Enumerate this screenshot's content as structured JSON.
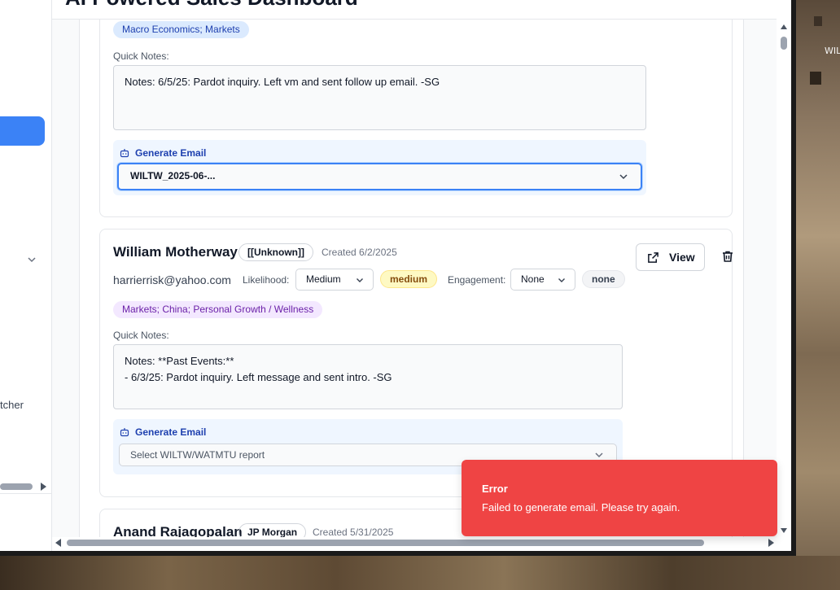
{
  "app": {
    "title": "AI Powered Sales Dashboard"
  },
  "sidebar": {
    "cut_text": "tcher"
  },
  "desktop": {
    "label": "WIL"
  },
  "cards": [
    {
      "tags": "Macro Economics; Markets",
      "notes_label": "Quick Notes:",
      "notes": "Notes: 6/5/25: Pardot inquiry. Left vm and sent follow up email. -SG",
      "generate_label": "Generate Email",
      "report_select": "WILTW_2025-06-..."
    },
    {
      "name": "William Motherway",
      "company": "[[Unknown]]",
      "created": "Created 6/2/2025",
      "email": "harrierrisk@yahoo.com",
      "likelihood_label": "Likelihood:",
      "likelihood_value": "Medium",
      "likelihood_badge": "medium",
      "engagement_label": "Engagement:",
      "engagement_value": "None",
      "engagement_badge": "none",
      "view_label": "View",
      "tags": "Markets; China; Personal Growth / Wellness",
      "notes_label": "Quick Notes:",
      "notes": "Notes: **Past Events:**\n- 6/3/25: Pardot inquiry. Left message and sent intro. -SG",
      "generate_label": "Generate Email",
      "report_placeholder": "Select WILTW/WATMTU report"
    },
    {
      "name": "Anand Rajagopalan",
      "company": "JP Morgan",
      "created": "Created 5/31/2025"
    }
  ],
  "toast": {
    "title": "Error",
    "message": "Failed to generate email. Please try again."
  },
  "colors": {
    "accent": "#3b82f6",
    "error": "#ef4444",
    "tag_blue_bg": "#dbeafe",
    "tag_purple_bg": "#f3e8ff"
  }
}
